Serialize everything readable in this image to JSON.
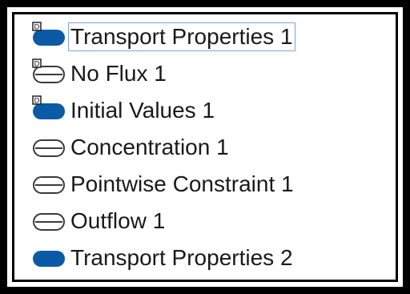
{
  "tree": {
    "items": [
      {
        "label": "Transport Properties 1",
        "icon": "domain-feature-default-icon",
        "selected": true
      },
      {
        "label": "No Flux 1",
        "icon": "boundary-feature-default-icon",
        "selected": false
      },
      {
        "label": "Initial Values 1",
        "icon": "domain-feature-default-icon",
        "selected": false
      },
      {
        "label": "Concentration 1",
        "icon": "boundary-feature-icon",
        "selected": false
      },
      {
        "label": "Pointwise Constraint 1",
        "icon": "boundary-feature-icon",
        "selected": false
      },
      {
        "label": "Outflow 1",
        "icon": "boundary-feature-icon",
        "selected": false
      },
      {
        "label": "Transport Properties 2",
        "icon": "domain-feature-icon",
        "selected": false
      }
    ]
  },
  "colors": {
    "domain_fill": "#0b5aa6",
    "boundary_fill": "#ffffff",
    "boundary_stroke": "#3a3a3a",
    "selection_outline": "#7aa7d8"
  }
}
